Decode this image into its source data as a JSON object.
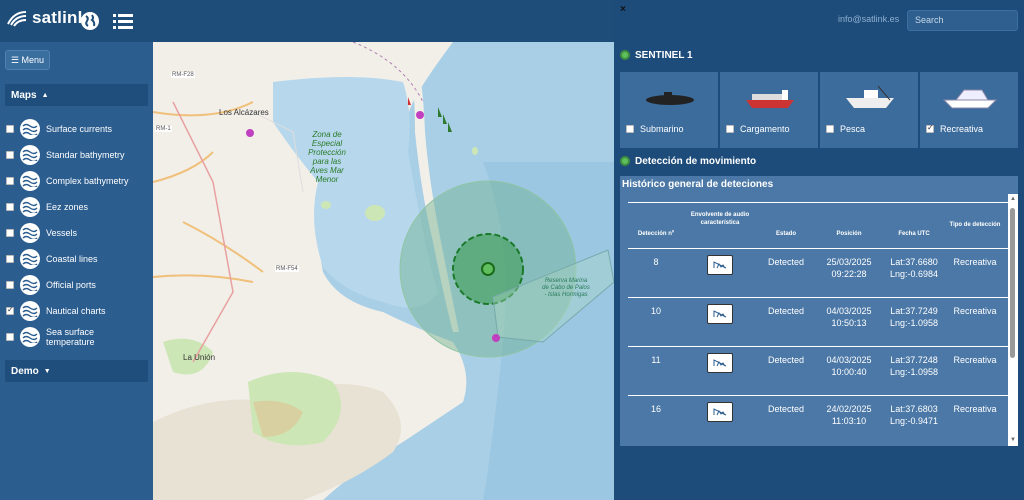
{
  "app": {
    "brand": "satlink",
    "user_email": "info@satlink.es",
    "search_placeholder": "Search"
  },
  "sidebar": {
    "menu_label": "☰ Menu",
    "maps_title": "Maps",
    "demo_title": "Demo",
    "layers": [
      {
        "label": "Surface currents",
        "checked": false
      },
      {
        "label": "Standar bathymetry",
        "checked": false
      },
      {
        "label": "Complex bathymetry",
        "checked": false
      },
      {
        "label": "Eez zones",
        "checked": false
      },
      {
        "label": "Vessels",
        "checked": false
      },
      {
        "label": "Coastal lines",
        "checked": false
      },
      {
        "label": "Official ports",
        "checked": false
      },
      {
        "label": "Nautical charts",
        "checked": true
      },
      {
        "label": "Sea surface temperature",
        "checked": false
      }
    ]
  },
  "map": {
    "labels": {
      "alcazares": "Los Alcázares",
      "zona": "Zona de Especial Protección para las Aves Mar Menor",
      "launion": "La Unión",
      "rm_f28": "RM-F28",
      "rm_f54": "RM-F54",
      "rm_1": "RM-1",
      "reserva": "Reserva Marina de Cabo de Palos - Islas Hormigas"
    },
    "colors": {
      "sea": "#a9cfe6",
      "land": "#f2efe9",
      "green": "#cde6b5",
      "detection": "#2e9a3e"
    }
  },
  "panel": {
    "close": "×",
    "sentinel_title": "SENTINEL 1",
    "vessel_types": [
      {
        "label": "Submarino",
        "checked": false,
        "icon": "submarine-icon"
      },
      {
        "label": "Cargamento",
        "checked": false,
        "icon": "cargo-ship-icon"
      },
      {
        "label": "Pesca",
        "checked": false,
        "icon": "fishing-boat-icon"
      },
      {
        "label": "Recreativa",
        "checked": true,
        "icon": "yacht-icon"
      }
    ],
    "movement_title": "Detección de movimiento",
    "history_title": "Histórico general de deteciones",
    "table": {
      "headers": [
        "Detección nº",
        "Envolvente de audio característica",
        "Estado",
        "Posición",
        "Fecha UTC",
        "Tipo de detección"
      ],
      "rows": [
        {
          "id": "8",
          "estado": "Detected",
          "fecha": "25/03/2025",
          "hora": "09:22:28",
          "lat": "Lat:37.6680",
          "lng": "Lng:-0.6984",
          "tipo": "Recreativa"
        },
        {
          "id": "10",
          "estado": "Detected",
          "fecha": "04/03/2025",
          "hora": "10:50:13",
          "lat": "Lat:37.7249",
          "lng": "Lng:-1.0958",
          "tipo": "Recreativa"
        },
        {
          "id": "11",
          "estado": "Detected",
          "fecha": "04/03/2025",
          "hora": "10:00:40",
          "lat": "Lat:37.7248",
          "lng": "Lng:-1.0958",
          "tipo": "Recreativa"
        },
        {
          "id": "16",
          "estado": "Detected",
          "fecha": "24/02/2025",
          "hora": "11:03:10",
          "lat": "Lat:37.6803",
          "lng": "Lng:-0.9471",
          "tipo": "Recreativa"
        }
      ]
    }
  }
}
